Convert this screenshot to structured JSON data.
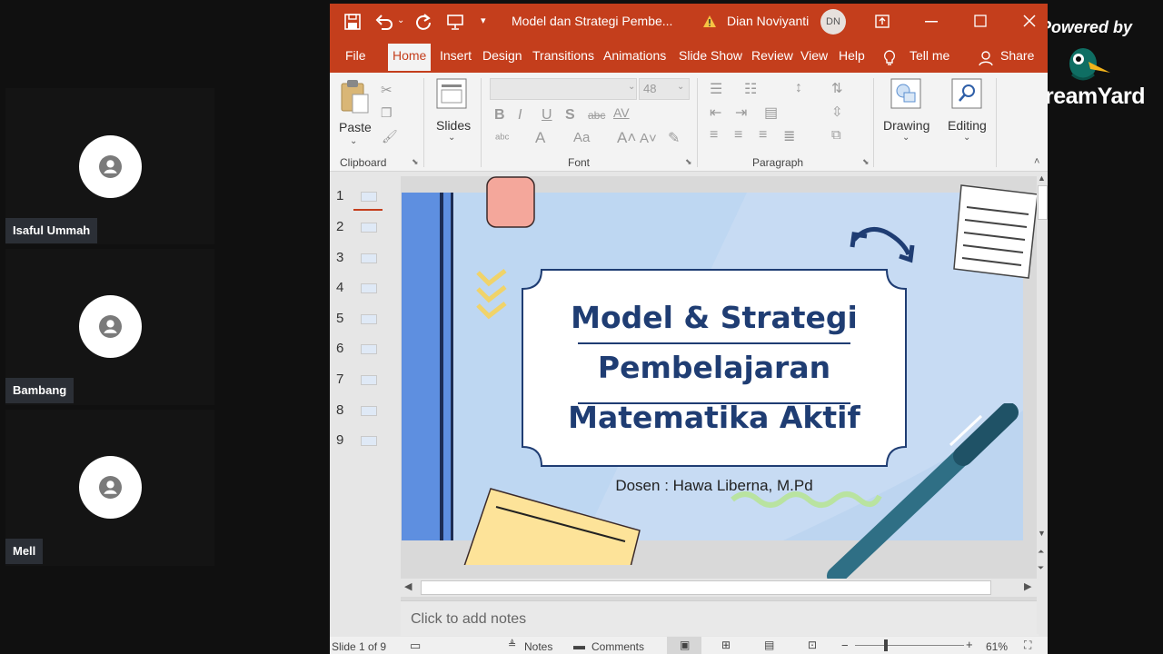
{
  "participants": [
    {
      "name": "Isaful Ummah"
    },
    {
      "name": "Bambang"
    },
    {
      "name": "Mell"
    }
  ],
  "branding": {
    "powered_by": "Powered by",
    "brand": "StreamYard"
  },
  "window": {
    "doc_title": "Model dan Strategi Pembe...",
    "user_name": "Dian Noviyanti",
    "user_initials": "DN"
  },
  "ribbon_tabs": [
    "File",
    "Home",
    "Insert",
    "Design",
    "Transitions",
    "Animations",
    "Slide Show",
    "Review",
    "View",
    "Help"
  ],
  "tell_me": "Tell me",
  "share": "Share",
  "ribbon": {
    "paste": "Paste",
    "slides": "Slides",
    "font_size": "48",
    "drawing": "Drawing",
    "editing": "Editing",
    "groups": {
      "clipboard": "Clipboard",
      "font": "Font",
      "paragraph": "Paragraph"
    }
  },
  "slide_numbers": [
    "1",
    "2",
    "3",
    "4",
    "5",
    "6",
    "7",
    "8",
    "9"
  ],
  "slide": {
    "title_line1": "Model & Strategi",
    "title_line2": "Pembelajaran",
    "title_line3": "Matematika Aktif",
    "subtitle": "Dosen : Hawa Liberna, M.Pd"
  },
  "notes_placeholder": "Click to add notes",
  "status": {
    "slide_counter": "Slide 1 of 9",
    "notes": "Notes",
    "comments": "Comments",
    "zoom": "61%"
  },
  "colors": {
    "accent": "#c43e1c",
    "slide_bg": "#c7dbf3",
    "title_text": "#1f3d73"
  }
}
